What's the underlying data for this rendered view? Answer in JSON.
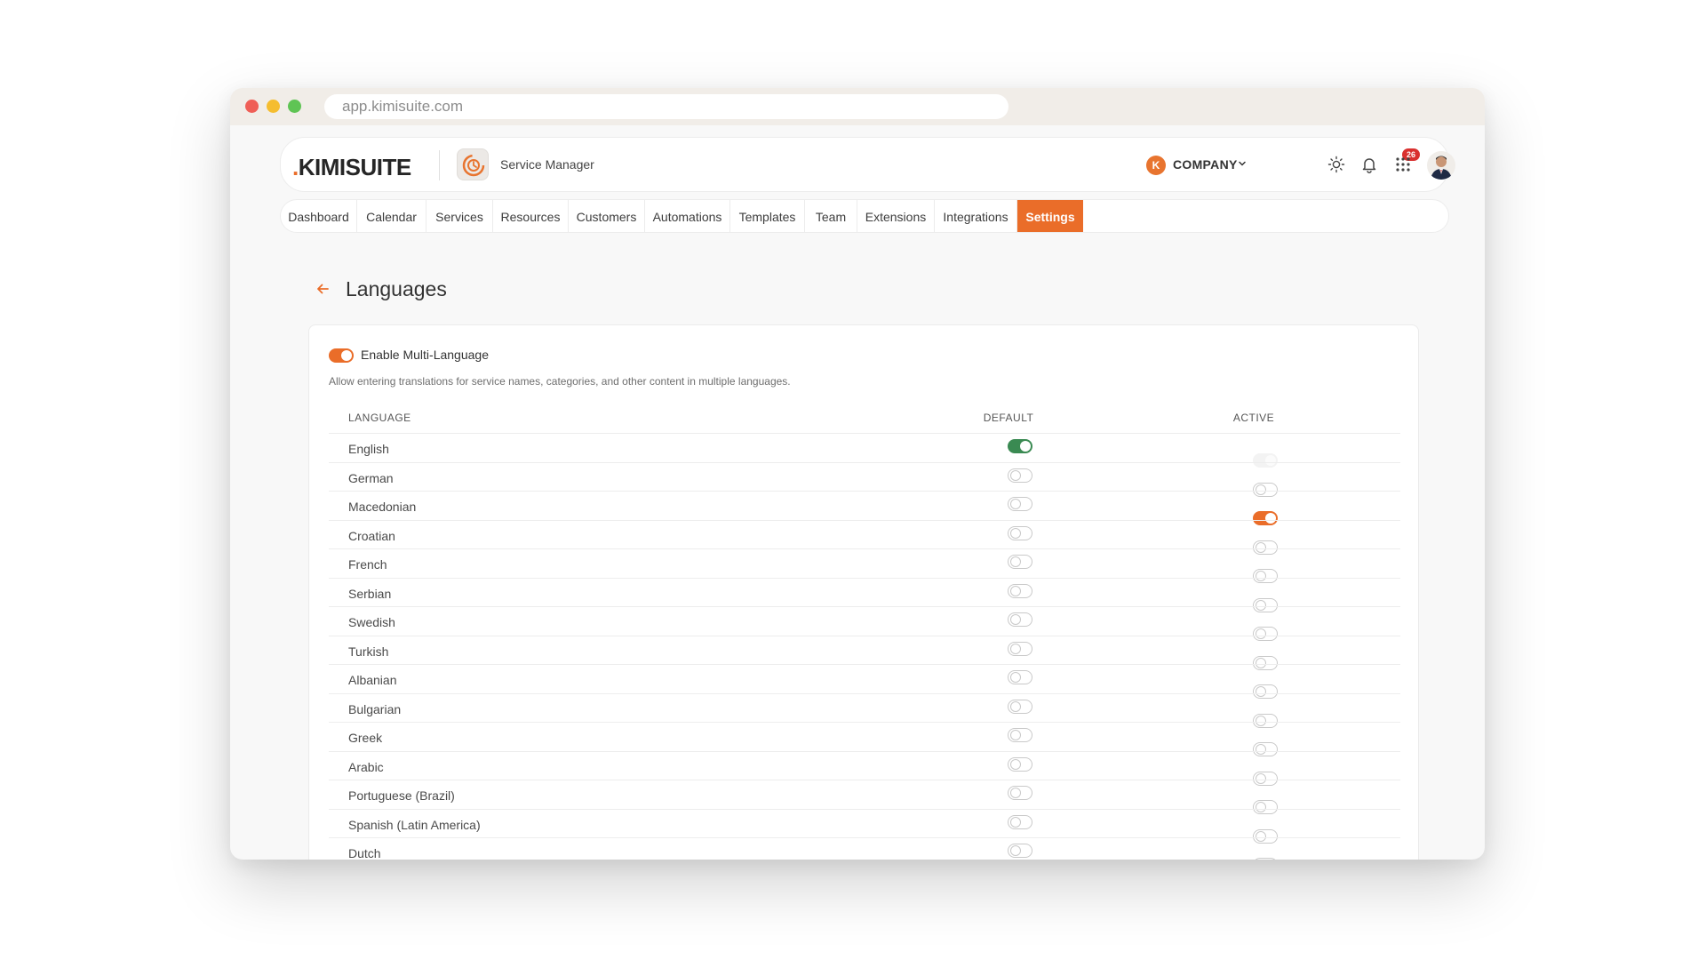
{
  "browser": {
    "url": "app.kimisuite.com"
  },
  "header": {
    "logo_dot": ".",
    "logo_text": "KIMISUITE",
    "app_name": "Service Manager",
    "company_initial": "K",
    "company_name": "COMPANY",
    "notification_count": "26"
  },
  "nav": {
    "tabs": [
      {
        "label": "Dashboard"
      },
      {
        "label": "Calendar"
      },
      {
        "label": "Services"
      },
      {
        "label": "Resources"
      },
      {
        "label": "Customers"
      },
      {
        "label": "Automations"
      },
      {
        "label": "Templates"
      },
      {
        "label": "Team"
      },
      {
        "label": "Extensions"
      },
      {
        "label": "Integrations"
      },
      {
        "label": "Settings",
        "active": true
      }
    ]
  },
  "page": {
    "title": "Languages"
  },
  "multi_language": {
    "enabled": true,
    "label": "Enable Multi-Language",
    "description": "Allow entering translations for service names, categories, and other content in multiple languages."
  },
  "table": {
    "headers": {
      "language": "LANGUAGE",
      "default": "DEFAULT",
      "active": "ACTIVE"
    },
    "rows": [
      {
        "name": "English",
        "default": "on",
        "active": "disabled"
      },
      {
        "name": "German",
        "default": "off",
        "active": "off"
      },
      {
        "name": "Macedonian",
        "default": "off",
        "active": "on"
      },
      {
        "name": "Croatian",
        "default": "off",
        "active": "off"
      },
      {
        "name": "French",
        "default": "off",
        "active": "off"
      },
      {
        "name": "Serbian",
        "default": "off",
        "active": "off"
      },
      {
        "name": "Swedish",
        "default": "off",
        "active": "off"
      },
      {
        "name": "Turkish",
        "default": "off",
        "active": "off"
      },
      {
        "name": "Albanian",
        "default": "off",
        "active": "off"
      },
      {
        "name": "Bulgarian",
        "default": "off",
        "active": "off"
      },
      {
        "name": "Greek",
        "default": "off",
        "active": "off"
      },
      {
        "name": "Arabic",
        "default": "off",
        "active": "off"
      },
      {
        "name": "Portuguese (Brazil)",
        "default": "off",
        "active": "off"
      },
      {
        "name": "Spanish (Latin America)",
        "default": "off",
        "active": "off"
      },
      {
        "name": "Dutch",
        "default": "off",
        "active": "off"
      }
    ]
  },
  "colors": {
    "accent": "#ea6d29",
    "default_on": "#3a8a52",
    "badge": "#d9302f"
  },
  "icons": [
    "back-arrow-icon",
    "sun-icon",
    "bell-icon",
    "apps-grid-icon",
    "chevron-down-icon",
    "service-manager-icon"
  ]
}
